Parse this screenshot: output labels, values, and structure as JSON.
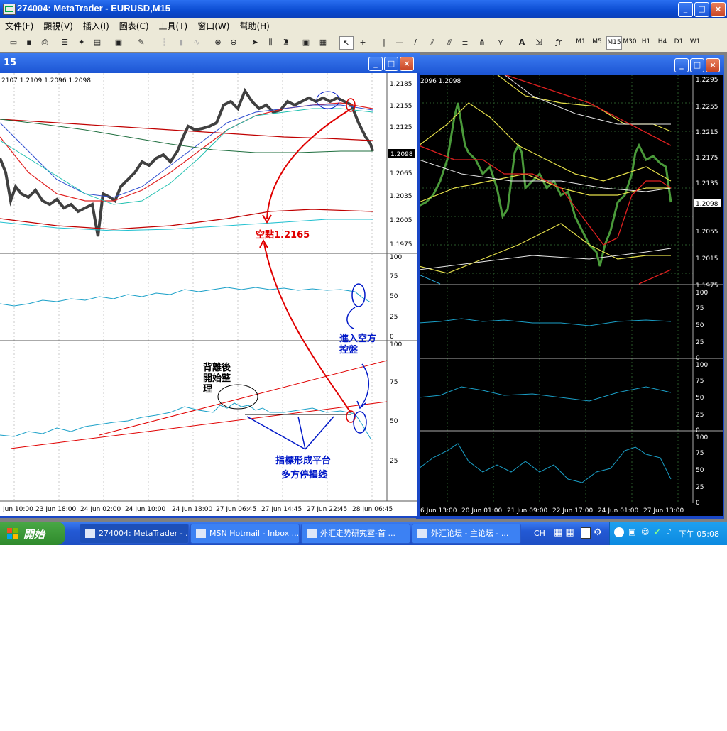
{
  "window": {
    "title": "274004: MetaTrader - EURUSD,M15",
    "min": "_",
    "max": "□",
    "close": "×"
  },
  "menu": [
    "文件(F)",
    "顯視(V)",
    "插入(I)",
    "圖表(C)",
    "工具(T)",
    "窗口(W)",
    "幫助(H)"
  ],
  "timeframes": [
    "M1",
    "M5",
    "M15",
    "M30",
    "H1",
    "H4",
    "D1",
    "W1"
  ],
  "selected_timeframe": "M15",
  "toolbar_text": {
    "text_tool": "A",
    "fib_tool": "ƒr"
  },
  "left_chart": {
    "title": "15",
    "ohlc_text": "2107 1.2109 1.2096 1.2098",
    "price_ticks": [
      "1.2185",
      "1.2155",
      "1.2125",
      "1.2098",
      "1.2065",
      "1.2035",
      "1.2005",
      "1.1975"
    ],
    "current_price": "1.2098",
    "rsi1_ticks": [
      "100",
      "75",
      "50",
      "25",
      "0"
    ],
    "rsi2_ticks": [
      "100",
      "75",
      "50",
      "25"
    ],
    "x_ticks": [
      "Jun 10:00",
      "23 Jun 18:00",
      "24 Jun 02:00",
      "24 Jun 10:00",
      "24 Jun 18:00",
      "27 Jun 06:45",
      "27 Jun 14:45",
      "27 Jun 22:45",
      "28 Jun 06:45"
    ]
  },
  "annotations": {
    "short_point": "空點1.2165",
    "enter_short_1": "進入空方",
    "enter_short_2": "控盤",
    "divergence_1": "背離後",
    "divergence_2": "開始整",
    "divergence_3": "理",
    "platform_1": "指標形成平台",
    "platform_2": "多方停損线"
  },
  "right_chart": {
    "ohlc_text": "2096 1.2098",
    "price_ticks": [
      "1.2295",
      "1.2255",
      "1.2215",
      "1.2175",
      "1.2135",
      "1.2098",
      "1.2055",
      "1.2015",
      "1.1975"
    ],
    "current_price": "1.2098",
    "sub_ticks": [
      "100",
      "75",
      "50",
      "25",
      "0"
    ],
    "x_ticks": [
      "6 Jun 13:00",
      "20 Jun 01:00",
      "21 Jun 09:00",
      "22 Jun 17:00",
      "24 Jun 01:00",
      "27 Jun 13:00"
    ]
  },
  "taskbar": {
    "start": "開始",
    "tasks": [
      "274004: MetaTrader - ...",
      "MSN Hotmail - Inbox ...",
      "外汇走势研究室-首 ...",
      "外汇论坛 - 主论坛 - ..."
    ],
    "lang": "CH",
    "clock": "下午 05:08"
  },
  "colors": {
    "accent_red": "#e00000",
    "annotation_blue": "#0018c8",
    "osc_line": "#1aa0c8",
    "right_bg": "#000000"
  }
}
